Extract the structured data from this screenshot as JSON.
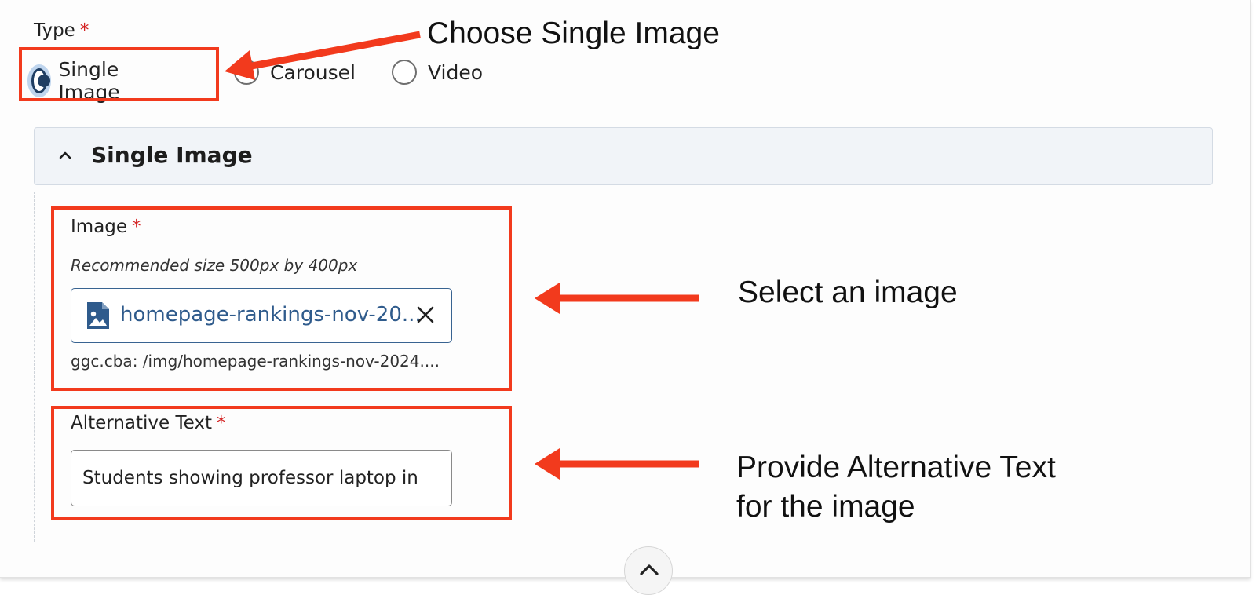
{
  "type_field": {
    "label": "Type",
    "required_mark": "*",
    "options": [
      {
        "label": "Single Image",
        "selected": true
      },
      {
        "label": "Carousel",
        "selected": false
      },
      {
        "label": "Video",
        "selected": false
      }
    ]
  },
  "accordion": {
    "title": "Single Image",
    "expanded": true
  },
  "image_field": {
    "label": "Image",
    "required_mark": "*",
    "hint": "Recommended size 500px by 400px",
    "file_name": "homepage-rankings-nov-20...",
    "path": "ggc.cba: /img/homepage-rankings-nov-2024...."
  },
  "alt_field": {
    "label": "Alternative Text",
    "required_mark": "*",
    "value": "Students showing professor laptop in"
  },
  "annotations": {
    "choose": "Choose Single Image",
    "select": "Select an image",
    "provide_line1": "Provide Alternative Text",
    "provide_line2": "for the image"
  },
  "icons": {
    "chevron": "chevron-up-icon",
    "file": "image-file-icon",
    "close": "close-icon",
    "scroll_top": "chevron-up-icon"
  },
  "colors": {
    "annotation_red": "#f23a1d",
    "accent_blue": "#2f5b8c",
    "required_red": "#d32121",
    "radio_selected": "#1f3e63"
  }
}
